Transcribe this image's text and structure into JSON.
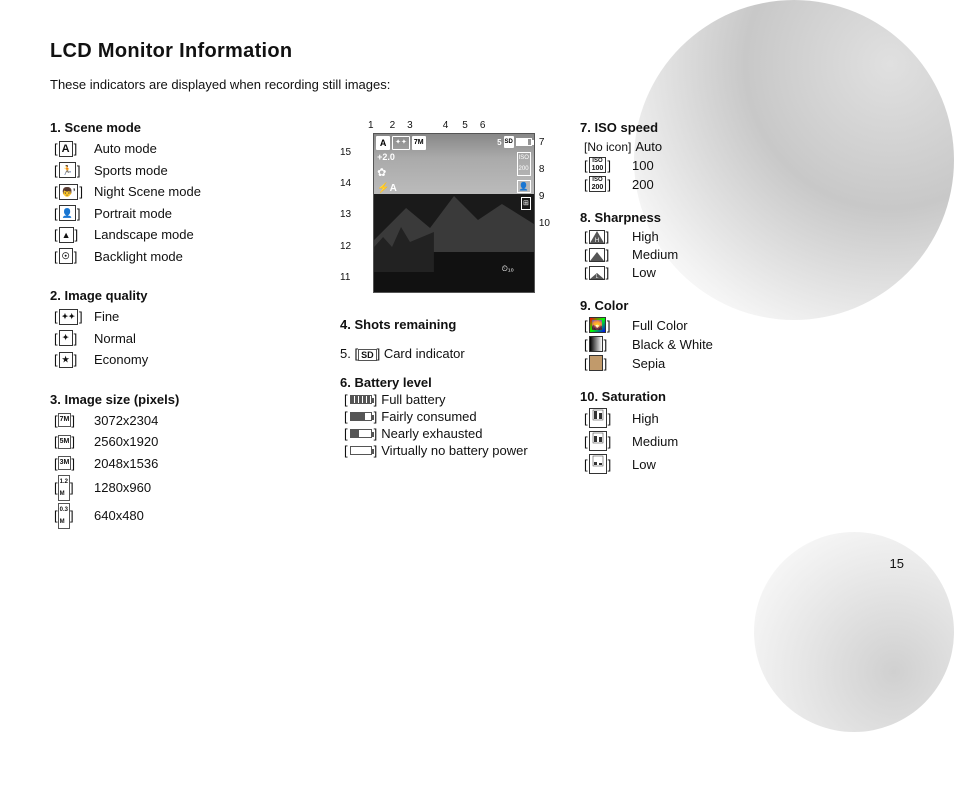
{
  "page": {
    "title": "LCD Monitor Information",
    "subtitle": "These indicators are displayed when recording still images:",
    "page_number": "15"
  },
  "section1": {
    "title": "1. Scene mode",
    "items": [
      {
        "icon": "A",
        "label": "Auto mode"
      },
      {
        "icon": "🏃",
        "label": "Sports mode"
      },
      {
        "icon": "🌙",
        "label": "Night Scene mode"
      },
      {
        "icon": "👤",
        "label": "Portrait mode"
      },
      {
        "icon": "▲",
        "label": "Landscape mode"
      },
      {
        "icon": "☀",
        "label": "Backlight mode"
      }
    ]
  },
  "section2": {
    "title": "2. Image quality",
    "items": [
      {
        "icon": "✦✦",
        "label": "Fine"
      },
      {
        "icon": "✦",
        "label": "Normal"
      },
      {
        "icon": "★",
        "label": "Economy"
      }
    ]
  },
  "section3": {
    "title": "3. Image size (pixels)",
    "items": [
      {
        "badge": "7M",
        "label": "3072x2304"
      },
      {
        "badge": "5M",
        "label": "2560x1920"
      },
      {
        "badge": "3M",
        "label": "2048x1536"
      },
      {
        "badge": "1.2",
        "label": "1280x960"
      },
      {
        "badge": "0.3",
        "label": "640x480"
      }
    ]
  },
  "section4": {
    "title": "4.  Shots remaining",
    "label": "Shots remaining"
  },
  "section5": {
    "title": "5. [SD] Card indicator",
    "label": "Card indicator"
  },
  "section6": {
    "title": "6. Battery level",
    "items": [
      {
        "battery": "full",
        "label": "Full battery"
      },
      {
        "battery": "3q",
        "label": "Fairly consumed"
      },
      {
        "battery": "half",
        "label": "Nearly exhausted"
      },
      {
        "battery": "low",
        "label": "Virtually no battery power"
      }
    ]
  },
  "section7": {
    "title": "7. ISO speed",
    "items": [
      {
        "icon": "[No icon]",
        "label": "Auto"
      },
      {
        "icon": "ISO100",
        "label": "100"
      },
      {
        "icon": "ISO200",
        "label": "200"
      }
    ]
  },
  "section8": {
    "title": "8. Sharpness",
    "items": [
      {
        "icon": "H",
        "label": "High"
      },
      {
        "icon": "M",
        "label": "Medium"
      },
      {
        "icon": "L",
        "label": "Low"
      }
    ]
  },
  "section9": {
    "title": "9. Color",
    "items": [
      {
        "icon": "FC",
        "label": "Full Color"
      },
      {
        "icon": "BW",
        "label": "Black & White"
      },
      {
        "icon": "S",
        "label": "Sepia"
      }
    ]
  },
  "section10": {
    "title": "10. Saturation",
    "items": [
      {
        "icon": "H",
        "label": "High"
      },
      {
        "icon": "M",
        "label": "Medium"
      },
      {
        "icon": "L",
        "label": "Low"
      }
    ]
  },
  "diagram": {
    "numbers_top": [
      "1",
      "2",
      "3",
      "4",
      "5",
      "6"
    ],
    "numbers_left": [
      "15",
      "14",
      "13",
      "12",
      "11"
    ],
    "numbers_right": [
      "7",
      "8",
      "9",
      "10"
    ]
  }
}
